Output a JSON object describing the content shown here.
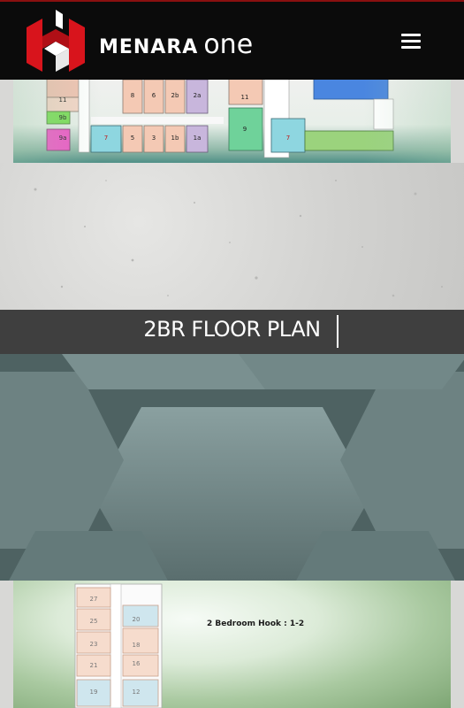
{
  "header": {
    "brand_name": "MENARA",
    "brand_suffix": "one",
    "menu_icon": "hamburger-icon"
  },
  "top_plan": {
    "units": [
      "11",
      "8",
      "6",
      "2b",
      "2a",
      "9b",
      "9a",
      "7",
      "5",
      "3",
      "1b",
      "1a",
      "11",
      "9",
      "7"
    ]
  },
  "section": {
    "title": "2BR FLOOR PLAN"
  },
  "bottom_plan": {
    "caption": "2 Bedroom Hook    : 1-2",
    "units": [
      "27",
      "25",
      "23",
      "21",
      "19",
      "20",
      "18",
      "16",
      "12"
    ]
  }
}
